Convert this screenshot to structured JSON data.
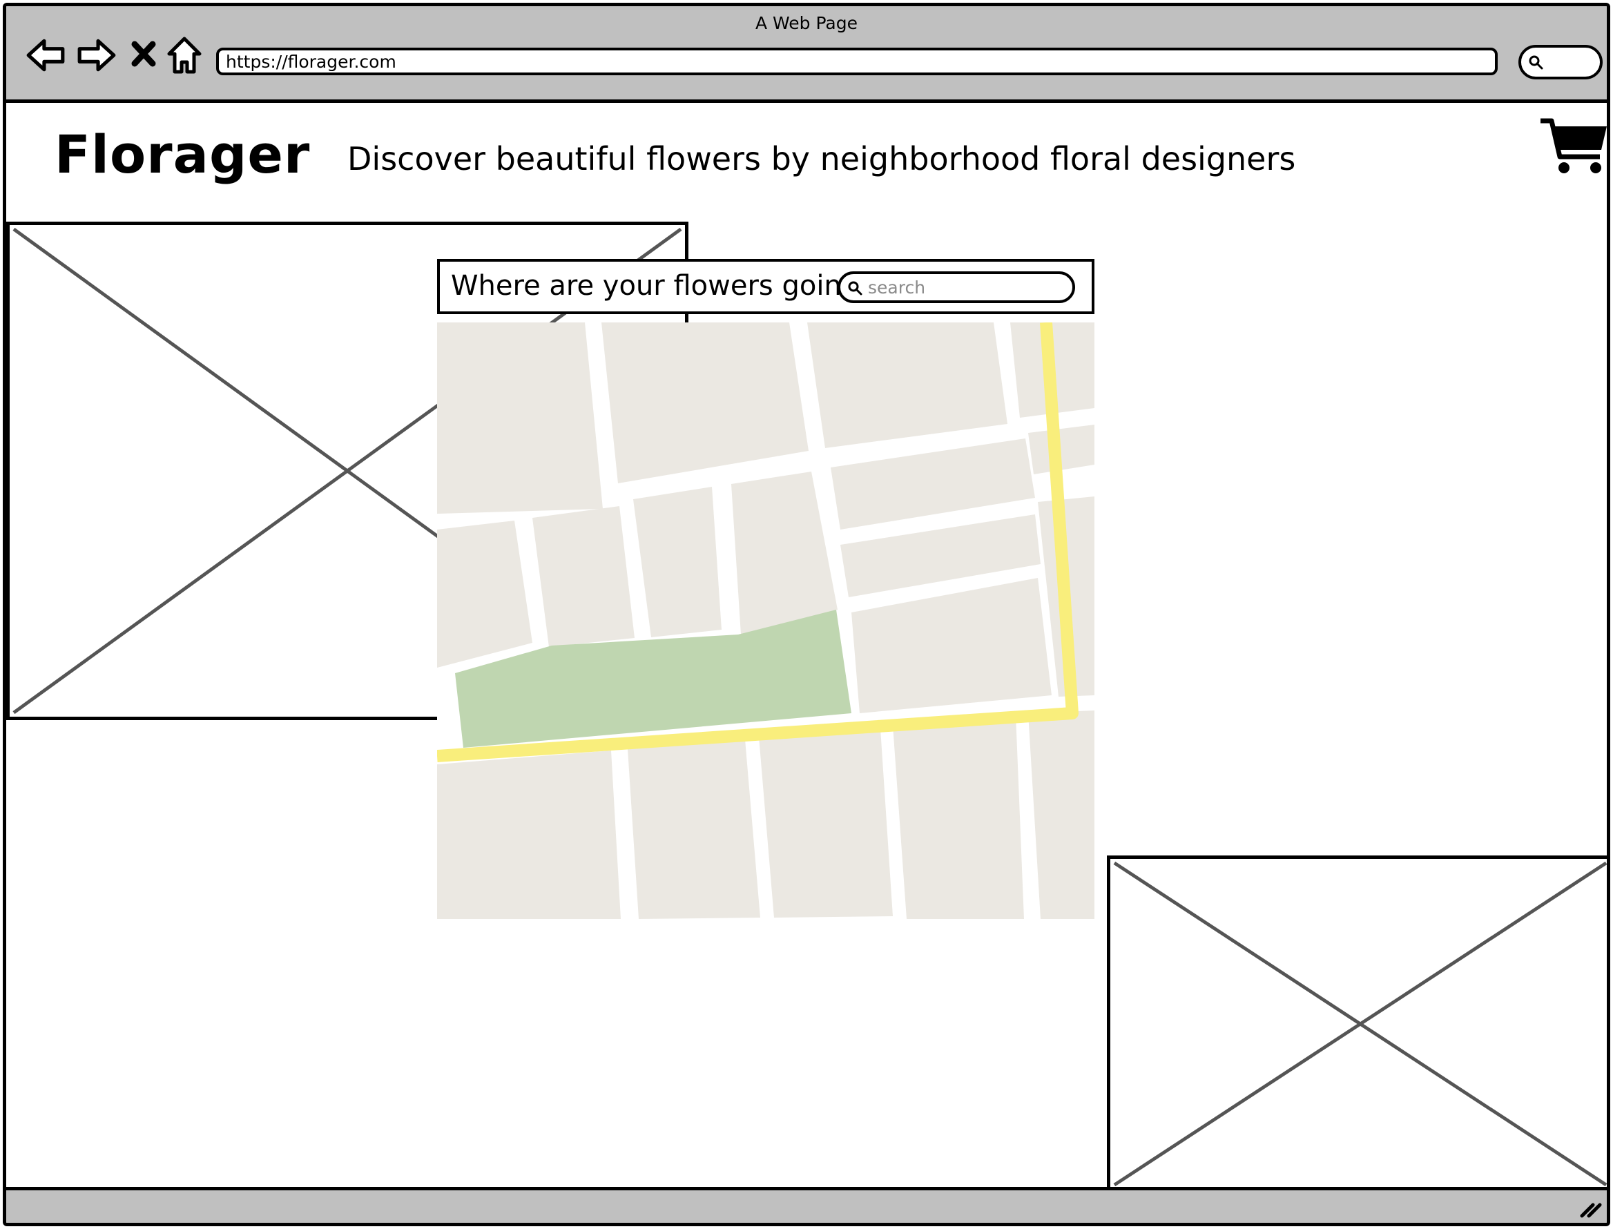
{
  "window": {
    "title": "A Web Page",
    "url": "https://florager.com"
  },
  "header": {
    "logo": "Florager",
    "tagline": "Discover beautiful flowers by neighborhood floral designers"
  },
  "search": {
    "question": "Where are your flowers going?",
    "placeholder": "search",
    "value": ""
  },
  "icons": {
    "back": "back-arrow-icon",
    "forward": "forward-arrow-icon",
    "stop": "close-icon",
    "home": "home-icon",
    "chrome_search": "search-icon",
    "cart": "shopping-cart-icon",
    "resize": "resize-grip-icon"
  },
  "colors": {
    "chrome": "#c0c0c0",
    "map_block": "#ebe8e2",
    "map_park": "#bfd6b0",
    "map_highway": "#f9ee7c",
    "placeholder_cross": "#555555"
  }
}
